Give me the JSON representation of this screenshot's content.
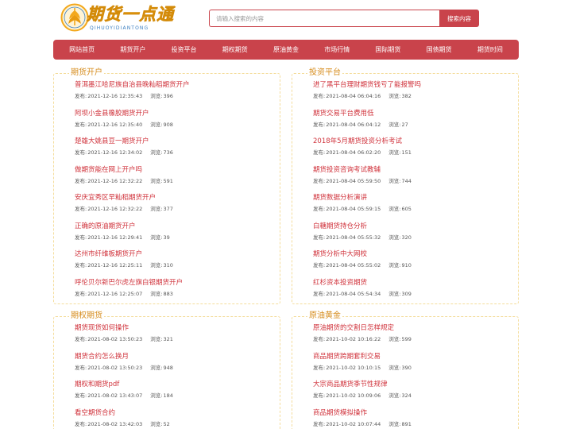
{
  "header": {
    "logo_title": "期货一点通",
    "logo_sub": "QIHUOYIDIANTONG",
    "search_placeholder": "请输入搜索的内容",
    "search_button": "搜索内容"
  },
  "colors": {
    "accent": "#c9434b",
    "title_red": "#d0333c",
    "section_orange": "#d68c1c",
    "logo_gold": "#f3a81b",
    "logo_blue": "#3b7fc1"
  },
  "nav": [
    "网站首页",
    "期货开户",
    "投资平台",
    "期权期货",
    "原油黄金",
    "市场行情",
    "国际期货",
    "国债期货",
    "期货时间"
  ],
  "labels": {
    "published": "发布:",
    "views": "浏览:"
  },
  "sections": [
    {
      "title": "期货开户",
      "items": [
        {
          "title": "普洱墨江哈尼族自治县晚籼稻期货开户",
          "date": "2021-12-16 12:35:43",
          "views": "396"
        },
        {
          "title": "阿坝小金县橡胶期货开户",
          "date": "2021-12-16 12:35:40",
          "views": "908"
        },
        {
          "title": "楚雄大姚县豆一期货开户",
          "date": "2021-12-16 12:34:02",
          "views": "736"
        },
        {
          "title": "做期货能在网上开户吗",
          "date": "2021-12-16 12:32:22",
          "views": "591"
        },
        {
          "title": "安庆宜秀区早籼稻期货开户",
          "date": "2021-12-16 12:32:22",
          "views": "377"
        },
        {
          "title": "正确的原油期货开户",
          "date": "2021-12-16 12:29:41",
          "views": "39"
        },
        {
          "title": "达州市纤维板期货开户",
          "date": "2021-12-16 12:25:11",
          "views": "310"
        },
        {
          "title": "呼伦贝尔新巴尔虎左旗白银期货开户",
          "date": "2021-12-16 12:25:07",
          "views": "883"
        }
      ]
    },
    {
      "title": "投资平台",
      "items": [
        {
          "title": "进了黑平台理财期货钱亏了能报警吗",
          "date": "2021-08-04 06:04:16",
          "views": "382"
        },
        {
          "title": "期货交易平台费用低",
          "date": "2021-08-04 06:04:12",
          "views": "27"
        },
        {
          "title": "2018年5月期货投资分析考试",
          "date": "2021-08-04 06:02:20",
          "views": "151"
        },
        {
          "title": "期货投资咨询考试教辅",
          "date": "2021-08-04 05:59:50",
          "views": "744"
        },
        {
          "title": "期货数据分析演讲",
          "date": "2021-08-04 05:59:15",
          "views": "605"
        },
        {
          "title": "白糖期货持仓分析",
          "date": "2021-08-04 05:55:32",
          "views": "320"
        },
        {
          "title": "期货分析中大网校",
          "date": "2021-08-04 05:55:02",
          "views": "910"
        },
        {
          "title": "红杉资本投资期货",
          "date": "2021-08-04 05:54:34",
          "views": "309"
        }
      ]
    },
    {
      "title": "期权期货",
      "items": [
        {
          "title": "期货现货如何操作",
          "date": "2021-08-02 13:50:23",
          "views": "321"
        },
        {
          "title": "期货合约怎么换月",
          "date": "2021-08-02 13:50:23",
          "views": "948"
        },
        {
          "title": "期权和期货pdf",
          "date": "2021-08-02 13:43:07",
          "views": "184"
        },
        {
          "title": "看空期货合约",
          "date": "2021-08-02 13:42:03",
          "views": "52"
        }
      ]
    },
    {
      "title": "原油黄金",
      "items": [
        {
          "title": "原油期货的交割日怎样规定",
          "date": "2021-10-02 10:16:22",
          "views": "599"
        },
        {
          "title": "商品期货跨期套利交易",
          "date": "2021-10-02 10:10:15",
          "views": "390"
        },
        {
          "title": "大宗商品期货季节性规律",
          "date": "2021-10-02 10:09:06",
          "views": "324"
        },
        {
          "title": "商品期货模拟操作",
          "date": "2021-10-02 10:07:44",
          "views": "891"
        }
      ]
    }
  ]
}
